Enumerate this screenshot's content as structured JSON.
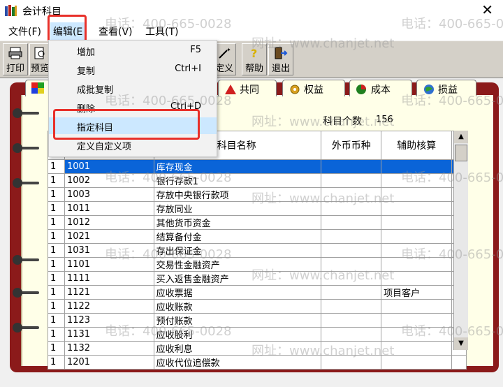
{
  "window": {
    "title": "会计科目",
    "close_glyph": "✕"
  },
  "menubar": {
    "items": [
      {
        "label": "文件(F)"
      },
      {
        "label": "编辑(E"
      },
      {
        "label": "查看(V)"
      },
      {
        "label": "工具(T)"
      }
    ]
  },
  "toolbar": {
    "buttons": [
      {
        "label": "打印",
        "icon": "printer-icon"
      },
      {
        "label": "预览",
        "icon": "preview-icon"
      },
      {
        "label": "定义",
        "icon": "define-icon"
      },
      {
        "label": "帮助",
        "icon": "help-icon"
      },
      {
        "label": "退出",
        "icon": "exit-icon"
      }
    ]
  },
  "edit_menu": {
    "items": [
      {
        "label": "增加",
        "shortcut": "F5"
      },
      {
        "label": "复制",
        "shortcut": "Ctrl+I"
      },
      {
        "label": "成批复制",
        "shortcut": ""
      },
      {
        "label": "删除",
        "shortcut": "Ctrl+D"
      },
      {
        "label": "指定科目",
        "shortcut": ""
      },
      {
        "label": "定义自定义项",
        "shortcut": ""
      }
    ],
    "highlighted": "指定科目"
  },
  "tabs": [
    {
      "label": "共同",
      "icon": "common-icon"
    },
    {
      "label": "权益",
      "icon": "equity-icon"
    },
    {
      "label": "成本",
      "icon": "cost-icon"
    },
    {
      "label": "损益",
      "icon": "profit-loss-icon"
    }
  ],
  "summary": {
    "count_label": "科目个数",
    "count_value": "156"
  },
  "table": {
    "headers": [
      "科目名称",
      "外币币种",
      "辅助核算"
    ],
    "rows": [
      {
        "level": "1",
        "code": "1001",
        "name": "库存现金",
        "currency": "",
        "aux": ""
      },
      {
        "level": "1",
        "code": "1002",
        "name": "银行存款1",
        "currency": "",
        "aux": ""
      },
      {
        "level": "1",
        "code": "1003",
        "name": "存放中央银行款项",
        "currency": "",
        "aux": ""
      },
      {
        "level": "1",
        "code": "1011",
        "name": "存放同业",
        "currency": "",
        "aux": ""
      },
      {
        "level": "1",
        "code": "1012",
        "name": "其他货币资金",
        "currency": "",
        "aux": ""
      },
      {
        "level": "1",
        "code": "1021",
        "name": "结算备付金",
        "currency": "",
        "aux": ""
      },
      {
        "level": "1",
        "code": "1031",
        "name": "存出保证金",
        "currency": "",
        "aux": ""
      },
      {
        "level": "1",
        "code": "1101",
        "name": "交易性金融资产",
        "currency": "",
        "aux": ""
      },
      {
        "level": "1",
        "code": "1111",
        "name": "买入返售金融资产",
        "currency": "",
        "aux": ""
      },
      {
        "level": "1",
        "code": "1121",
        "name": "应收票据",
        "currency": "",
        "aux": "项目客户"
      },
      {
        "level": "1",
        "code": "1122",
        "name": "应收账款",
        "currency": "",
        "aux": ""
      },
      {
        "level": "1",
        "code": "1123",
        "name": "预付账款",
        "currency": "",
        "aux": ""
      },
      {
        "level": "1",
        "code": "1131",
        "name": "应收股利",
        "currency": "",
        "aux": ""
      },
      {
        "level": "1",
        "code": "1132",
        "name": "应收利息",
        "currency": "",
        "aux": ""
      },
      {
        "level": "1",
        "code": "1201",
        "name": "应收代位追偿款",
        "currency": "",
        "aux": ""
      }
    ],
    "selected_row": 0
  },
  "watermark": {
    "phone": "电话：400-665-0028",
    "site": "网址：www.chanjet.net"
  },
  "colors": {
    "highlight_box": "#e8302a",
    "selection": "#0a64d8",
    "binder": "#8b1a1a",
    "menu_hover": "#cce8ff"
  }
}
